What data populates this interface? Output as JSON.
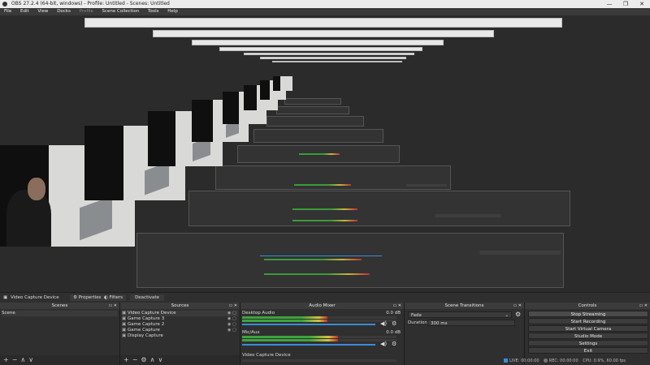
{
  "window": {
    "title": "OBS 27.2.4 (64-bit, windows) - Profile: Untitled - Scenes: Untitled"
  },
  "menu": [
    "File",
    "Edit",
    "View",
    "Docks",
    "Profile",
    "Scene Collection",
    "Tools",
    "Help"
  ],
  "source_bar": {
    "source_name": "Video Capture Device",
    "properties_label": "Properties",
    "filters_label": "Filters",
    "deactivate_label": "Deactivate"
  },
  "scenes": {
    "header": "Scenes",
    "items": [
      "Scene"
    ]
  },
  "sources": {
    "header": "Sources",
    "items": [
      "Video Capture Device",
      "Game Capture 3",
      "Game Capture 2",
      "Game Capture",
      "Display Capture"
    ]
  },
  "mixer": {
    "header": "Audio Mixer",
    "channels": [
      {
        "name": "Desktop Audio",
        "db": "0.0 dB",
        "level": 0.55
      },
      {
        "name": "Mic/Aux",
        "db": "0.0 dB",
        "level": 0.62
      },
      {
        "name": "Video Capture Device",
        "db": "",
        "level": 0.0
      }
    ]
  },
  "transitions": {
    "header": "Scene Transitions",
    "type": "Fade",
    "duration_label": "Duration",
    "duration_value": "300 ms"
  },
  "controls": {
    "header": "Controls",
    "buttons": [
      "Stop Streaming",
      "Start Recording",
      "Start Virtual Camera",
      "Studio Mode",
      "Settings",
      "Exit"
    ]
  },
  "status": {
    "live": "LIVE: 00:00:00",
    "rec": "REC: 00:00:00",
    "cpu": "CPU: 0.9%, 60.00 fps"
  }
}
